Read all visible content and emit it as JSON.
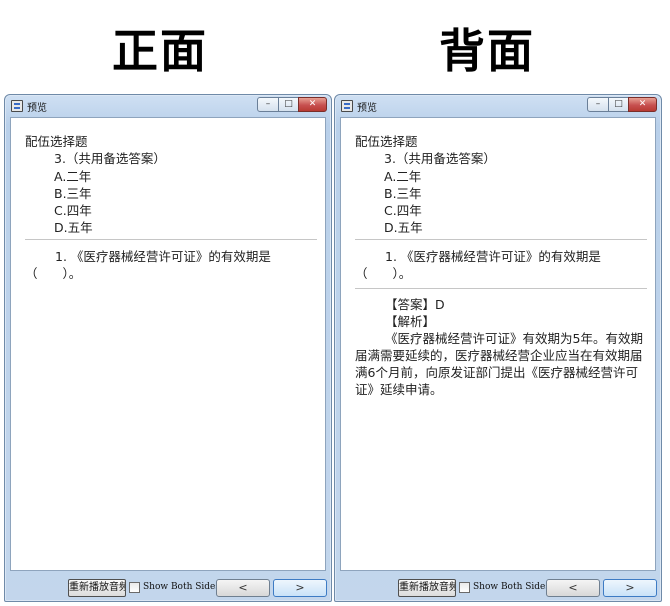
{
  "labels": {
    "front": "正面",
    "back": "背面"
  },
  "window": {
    "title": "预览",
    "minimize_icon": "minimize-icon",
    "maximize_icon": "maximize-icon",
    "close_icon": "close-icon"
  },
  "question": {
    "type": "配伍选择题",
    "number": "3.（共用备选答案）",
    "options": [
      "A.二年",
      "B.三年",
      "C.四年",
      "D.五年"
    ],
    "stem": "1. 《医疗器械经营许可证》的有效期是（　　）。"
  },
  "answer": {
    "answer_line": "【答案】D",
    "analysis_heading": "【解析】",
    "analysis_text": "《医疗器械经营许可证》有效期为5年。有效期届满需要延续的，医疗器械经营企业应当在有效期届满6个月前，向原发证部门提出《医疗器械经营许可证》延续申请。"
  },
  "footer": {
    "replay_label": "重新播放音频",
    "show_both_sides_label": "Show Both Sides",
    "show_both_sides_checked": false,
    "prev_label": "<",
    "next_label": ">"
  },
  "colors": {
    "close_button": "#c75050",
    "titlebar": "#c3d6ec",
    "next_button_border": "#3d7bc4"
  }
}
